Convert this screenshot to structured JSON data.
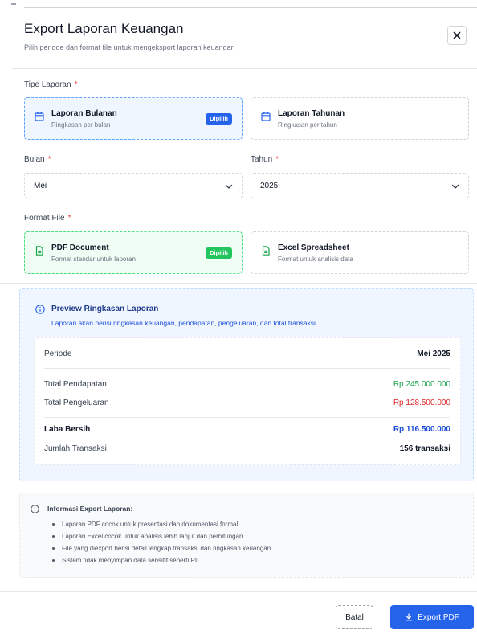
{
  "dialog": {
    "title": "Export Laporan Keuangan",
    "subtitle": "Pilih periode dan format file untuk mengeksport laporan keuangan",
    "close_label": "×"
  },
  "report_type": {
    "label": "Tipe Laporan",
    "required": "*",
    "options": [
      {
        "title": "Laporan Bulanan",
        "subtitle": "Ringkasan per bulan",
        "badge": "Dipilih",
        "selected": true,
        "icon": "calendar-icon"
      },
      {
        "title": "Laporan Tahunan",
        "subtitle": "Ringkasan per tahun",
        "badge": "",
        "selected": false,
        "icon": "calendar-icon"
      }
    ]
  },
  "month": {
    "label": "Bulan",
    "required": "*",
    "value": "Mei"
  },
  "year": {
    "label": "Tahun",
    "required": "*",
    "value": "2025"
  },
  "format": {
    "label": "Format File",
    "required": "*",
    "options": [
      {
        "title": "PDF Document",
        "subtitle": "Format standar untuk laporan",
        "badge": "Dipilih",
        "selected": true,
        "icon": "file-icon"
      },
      {
        "title": "Excel Spreadsheet",
        "subtitle": "Format untuk analisis data",
        "badge": "",
        "selected": false,
        "icon": "file-icon"
      }
    ]
  },
  "preview": {
    "title": "Preview Ringkasan Laporan",
    "description": "Laporan akan berisi ringkasan keuangan, pendapatan, pengeluaran, dan total transaksi",
    "period_label": "Periode",
    "period_value": "Mei 2025",
    "income_label": "Total Pendapatan",
    "income_value": "Rp 245.000.000",
    "expense_label": "Total Pengeluaran",
    "expense_value": "Rp 128.500.000",
    "net_label": "Laba Bersih",
    "net_value": "Rp 116.500.000",
    "tx_label": "Jumlah Transaksi",
    "tx_value": "156 transaksi",
    "colors": {
      "income": "#16a34a",
      "expense": "#dc2626",
      "net": "#1d4ed8"
    }
  },
  "info": {
    "title": "Informasi Export Laporan:",
    "items": [
      "Laporan PDF cocok untuk presentasi dan dokumentasi formal",
      "Laporan Excel cocok untuk analisis lebih lanjut dan perhitungan",
      "File yang diexport berisi detail lengkap transaksi dan ringkasan keuangan",
      "Sistem tidak menyimpan data sensitif seperti PII"
    ]
  },
  "footer": {
    "cancel_label": "Batal",
    "export_label": "Export PDF"
  }
}
